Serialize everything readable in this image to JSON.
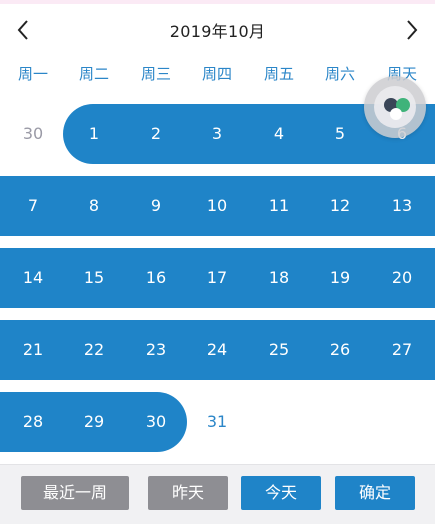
{
  "header": {
    "title": "2019年10月"
  },
  "weekdays": [
    "周一",
    "周二",
    "周三",
    "周四",
    "周五",
    "周六",
    "周天"
  ],
  "calendar": {
    "rows": [
      [
        "30",
        "1",
        "2",
        "3",
        "4",
        "5",
        "6"
      ],
      [
        "7",
        "8",
        "9",
        "10",
        "11",
        "12",
        "13"
      ],
      [
        "14",
        "15",
        "16",
        "17",
        "18",
        "19",
        "20"
      ],
      [
        "21",
        "22",
        "23",
        "24",
        "25",
        "26",
        "27"
      ],
      [
        "28",
        "29",
        "30",
        "31",
        "",
        "",
        ""
      ]
    ]
  },
  "footer": {
    "last_week": "最近一周",
    "yesterday": "昨天",
    "today": "今天",
    "confirm": "确定"
  },
  "colors": {
    "accent": "#1f84c8",
    "gray_button": "#8e8e93"
  },
  "icons": {
    "prev": "chevron-left-icon",
    "next": "chevron-right-icon",
    "assistive": "floating-assistive-icon"
  }
}
